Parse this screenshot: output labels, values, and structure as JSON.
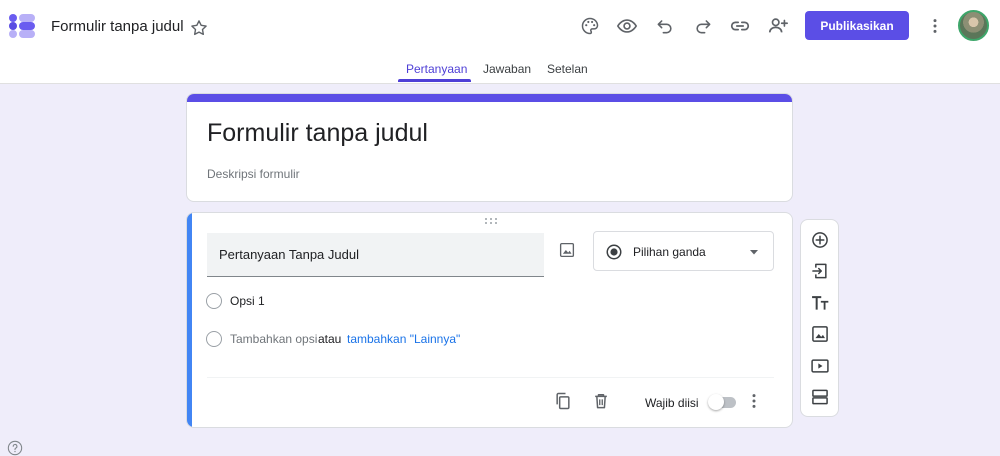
{
  "header": {
    "doc_title": "Formulir tanpa judul",
    "publish_label": "Publikasikan",
    "icons": [
      "forms-logo-icon",
      "star-icon",
      "palette-icon",
      "preview-eye-icon",
      "undo-icon",
      "redo-icon",
      "link-icon",
      "add-collaborator-icon",
      "more-vert-icon",
      "avatar"
    ]
  },
  "tabs": [
    {
      "label": "Pertanyaan",
      "active": true
    },
    {
      "label": "Jawaban",
      "active": false
    },
    {
      "label": "Setelan",
      "active": false
    }
  ],
  "form": {
    "title": "Formulir tanpa judul",
    "description_placeholder": "Deskripsi formulir"
  },
  "question": {
    "title": "Pertanyaan Tanpa Judul",
    "type_label": "Pilihan ganda",
    "option_1": "Opsi 1",
    "add_option": "Tambahkan opsi",
    "or_text": "atau",
    "add_other": "tambahkan \"Lainnya\"",
    "required_label": "Wajib diisi",
    "required": false
  },
  "side_toolbar": [
    "add-question-icon",
    "import-questions-icon",
    "add-title-icon",
    "add-image-icon",
    "add-video-icon",
    "add-section-icon"
  ],
  "colors": {
    "accent": "#5b4ee6",
    "active_question": "#4285f4",
    "link": "#1a73e8",
    "background": "#efedfa"
  }
}
